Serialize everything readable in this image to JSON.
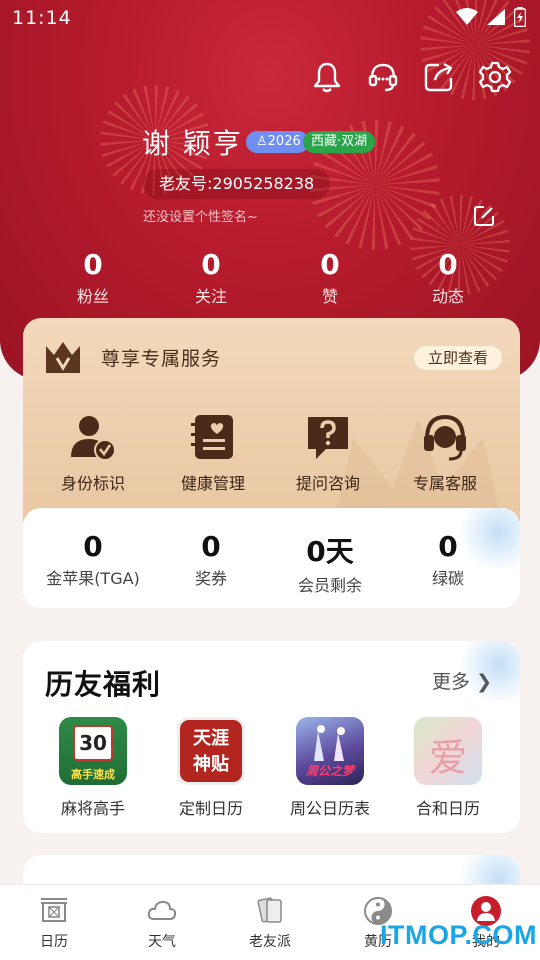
{
  "status_bar": {
    "time": "11:14"
  },
  "profile": {
    "name": "谢 颖亨",
    "year_badge": "2026",
    "location_badge": "西藏·双湖",
    "friend_id": "老友号:2905258238",
    "signature": "还没设置个性签名~"
  },
  "stats": [
    {
      "value": "0",
      "label": "粉丝"
    },
    {
      "value": "0",
      "label": "关注"
    },
    {
      "value": "0",
      "label": "赞"
    },
    {
      "value": "0",
      "label": "动态"
    }
  ],
  "vip": {
    "title": "尊享专属服务",
    "button": "立即查看",
    "items": [
      {
        "label": "身份标识",
        "icon": "user-badge-icon"
      },
      {
        "label": "健康管理",
        "icon": "health-record-icon"
      },
      {
        "label": "提问咨询",
        "icon": "question-chat-icon"
      },
      {
        "label": "专属客服",
        "icon": "headset-icon"
      }
    ]
  },
  "assets": [
    {
      "value": "0",
      "label": "金苹果(TGA)"
    },
    {
      "value": "0",
      "label": "奖券"
    },
    {
      "value": "0天",
      "label": "会员剩余"
    },
    {
      "value": "0",
      "label": "绿碳"
    }
  ],
  "welfare": {
    "title": "历友福利",
    "more": "更多",
    "apps": [
      {
        "label": "麻将高手",
        "icon_text": "30",
        "icon_caption": "高手速成"
      },
      {
        "label": "定制日历",
        "icon_text": "天涯",
        "icon_caption": "神贴"
      },
      {
        "label": "周公日历表",
        "icon_caption": "周公之梦"
      },
      {
        "label": "合和日历",
        "icon_text": "爱"
      }
    ]
  },
  "tabs": [
    {
      "label": "日历",
      "icon": "calendar-icon"
    },
    {
      "label": "天气",
      "icon": "cloud-icon"
    },
    {
      "label": "老友派",
      "icon": "cards-icon"
    },
    {
      "label": "黄历",
      "icon": "taiji-icon"
    },
    {
      "label": "我的",
      "icon": "profile-icon"
    }
  ],
  "watermark": "ITMOP.COM",
  "colors": {
    "header_red": "#b51b2c",
    "vip_gold": "#eccdaa",
    "accent_green": "#2aa54a",
    "accent_blue": "#6f8ff0"
  }
}
